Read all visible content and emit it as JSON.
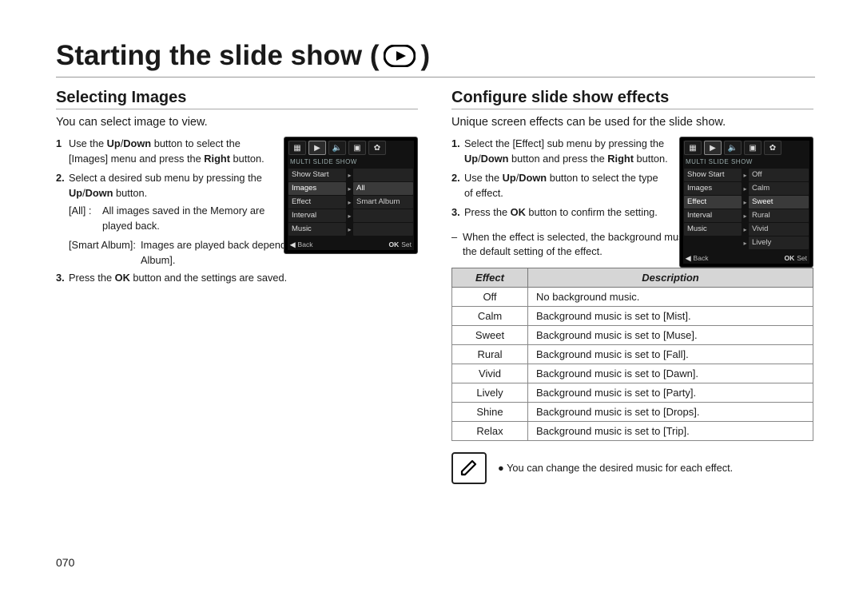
{
  "title": "Starting the slide show (",
  "title_close": ")",
  "left": {
    "heading": "Selecting Images",
    "intro": "You can select image to view.",
    "steps": [
      {
        "num": "1",
        "html": "Use the <b>Up</b>/<b>Down</b> button to select the [Images] menu and press the <b>Right</b> button."
      },
      {
        "num": "2.",
        "html": "Select a desired sub menu by pressing the <b>Up</b>/<b>Down</b> button."
      }
    ],
    "sub_all_lbl": "[All] :",
    "sub_all_txt": "All images saved in the Memory are played back.",
    "sub_sa_lbl": "[Smart Album]:",
    "sub_sa_txt": "Images are played back depending on the category of [Smart Album].",
    "step3": {
      "num": "3.",
      "html": "Press the <b>OK</b> button and the settings are saved."
    },
    "cam": {
      "title": "MULTI SLIDE SHOW",
      "rows": [
        {
          "label": "Show Start",
          "val": "",
          "sel": false
        },
        {
          "label": "Images",
          "val": "All",
          "sel": true
        },
        {
          "label": "Effect",
          "val": "Smart Album",
          "sel": false
        },
        {
          "label": "Interval",
          "val": "",
          "sel": false
        },
        {
          "label": "Music",
          "val": "",
          "sel": false
        }
      ],
      "foot_back": "Back",
      "foot_set": "Set"
    }
  },
  "right": {
    "heading": "Configure slide show effects",
    "intro": "Unique screen effects can be used for the slide show.",
    "steps": [
      {
        "num": "1.",
        "html": "Select the [Effect] sub menu by pressing the <b>Up</b>/<b>Down</b> button and press the <b>Right</b> button."
      },
      {
        "num": "2.",
        "html": "Use the <b>Up</b>/<b>Down</b> button to select the type of effect."
      },
      {
        "num": "3.",
        "html": "Press the <b>OK</b> button to confirm the setting."
      }
    ],
    "cam": {
      "title": "MULTI SLIDE SHOW",
      "rows": [
        {
          "label": "Show Start",
          "val": "Off",
          "sel": false
        },
        {
          "label": "Images",
          "val": "Calm",
          "sel": false
        },
        {
          "label": "Effect",
          "val": "Sweet",
          "sel": true
        },
        {
          "label": "Interval",
          "val": "Rural",
          "sel": false
        },
        {
          "label": "Music",
          "val": "Vivid",
          "sel": false
        },
        {
          "label": "",
          "val": "Lively",
          "sel": false
        }
      ],
      "foot_back": "Back",
      "foot_set": "Set"
    },
    "dash": "When the effect is selected, the background music is changed according to the default setting of the effect.",
    "table": {
      "head_effect": "Effect",
      "head_desc": "Description",
      "rows": [
        {
          "e": "Off",
          "d": "No background music."
        },
        {
          "e": "Calm",
          "d": "Background music is set to [Mist]."
        },
        {
          "e": "Sweet",
          "d": "Background music is set to [Muse]."
        },
        {
          "e": "Rural",
          "d": "Background music is set to [Fall]."
        },
        {
          "e": "Vivid",
          "d": "Background music is set to [Dawn]."
        },
        {
          "e": "Lively",
          "d": "Background music is set to [Party]."
        },
        {
          "e": "Shine",
          "d": "Background music is set to [Drops]."
        },
        {
          "e": "Relax",
          "d": "Background music is set to [Trip]."
        }
      ]
    },
    "note": "You can change the desired music for each effect."
  },
  "pagenum": "070"
}
